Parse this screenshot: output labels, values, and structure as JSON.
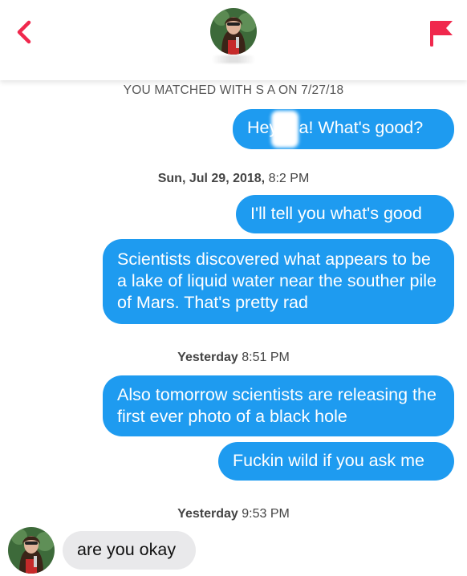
{
  "header": {
    "back_icon": "chevron-left-icon",
    "report_icon": "flag-icon",
    "accent_color": "#f0284d"
  },
  "matched_text": "YOU MATCHED WITH S A ON 7/27/18",
  "messages": [
    {
      "text": "Hey S   a! What's good?"
    },
    {
      "timestamp_bold": "Sun, Jul 29, 2018,",
      "timestamp_rest": "8:2  PM"
    },
    {
      "text": "I'll tell you what's good"
    },
    {
      "text": "Scientists discovered what appears to be a lake of liquid water near the souther pile of Mars. That's pretty rad"
    },
    {
      "timestamp_bold": "Yesterday",
      "timestamp_rest": "8:51 PM"
    },
    {
      "text": "Also tomorrow scientists are releasing the first ever photo of a black hole"
    },
    {
      "text": "Fuckin wild if you ask me"
    },
    {
      "timestamp_bold": "Yesterday",
      "timestamp_rest": "9:53 PM"
    },
    {
      "text": "are you okay"
    }
  ],
  "colors": {
    "outgoing_bubble": "#1e9bf0",
    "incoming_bubble": "#e9e9eb"
  }
}
